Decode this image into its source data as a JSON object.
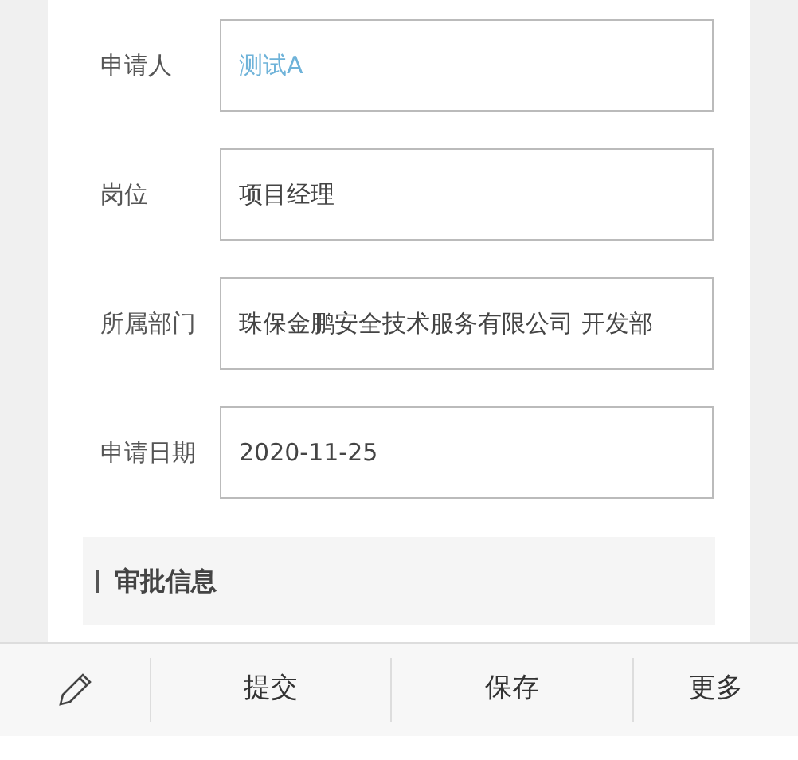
{
  "fields": [
    {
      "label": "申请人",
      "value": "测试A",
      "kind": "link"
    },
    {
      "label": "岗位",
      "value": "项目经理",
      "kind": "text"
    },
    {
      "label": "所属部门",
      "value": "珠保金鹏安全技术服务有限公司 开发部",
      "kind": "text"
    },
    {
      "label": "申请日期",
      "value": "2020-11-25",
      "kind": "text"
    }
  ],
  "section": {
    "title": "审批信息"
  },
  "actions": [
    "提交",
    "保存",
    "更多"
  ]
}
